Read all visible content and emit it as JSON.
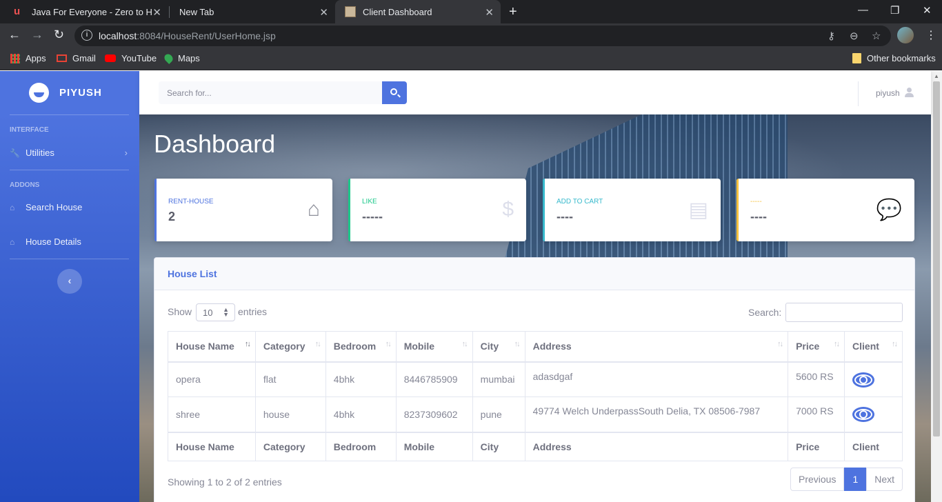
{
  "browser": {
    "tabs": [
      {
        "title": "Java For Everyone - Zero to Hero",
        "active": false
      },
      {
        "title": "New Tab",
        "active": false
      },
      {
        "title": "Client Dashboard",
        "active": true
      }
    ],
    "url_host": "localhost",
    "url_rest": ":8084/HouseRent/UserHome.jsp",
    "bookmarks": [
      "Apps",
      "Gmail",
      "YouTube",
      "Maps"
    ],
    "other_bookmarks": "Other bookmarks"
  },
  "sidebar": {
    "brand": "PIYUSH",
    "heading_interface": "INTERFACE",
    "utilities": "Utilities",
    "heading_addons": "ADDONS",
    "search_house": "Search House",
    "house_details": "House Details"
  },
  "topbar": {
    "search_placeholder": "Search for...",
    "user": "piyush"
  },
  "dashboard": {
    "title": "Dashboard",
    "cards": [
      {
        "label": "RENT-HOUSE",
        "value": "2",
        "accent": "#4e73df",
        "icon": "home-icon"
      },
      {
        "label": "LIKE",
        "value": "-----",
        "accent": "#1cc88a",
        "icon": "dollar-icon"
      },
      {
        "label": "ADD TO CART",
        "value": "----",
        "accent": "#36b9cc",
        "icon": "clipboard-icon"
      },
      {
        "label": "-----",
        "value": "----",
        "accent": "#f6c23e",
        "icon": "comments-icon"
      }
    ]
  },
  "house_list": {
    "title": "House List",
    "show": "Show",
    "page_size": "10",
    "entries": "entries",
    "search_label": "Search:",
    "columns": [
      "House Name",
      "Category",
      "Bedroom",
      "Mobile",
      "City",
      "Address",
      "Price",
      "Client"
    ],
    "rows": [
      {
        "name": "opera",
        "category": "flat",
        "bedroom": "4bhk",
        "mobile": "8446785909",
        "city": "mumbai",
        "address": "adasdgaf",
        "price": "5600 RS"
      },
      {
        "name": "shree",
        "category": "house",
        "bedroom": "4bhk",
        "mobile": "8237309602",
        "city": "pune",
        "address": "49774 Welch UnderpassSouth Delia, TX 08506-7987",
        "price": "7000 RS"
      }
    ],
    "info": "Showing 1 to 2 of 2 entries",
    "prev": "Previous",
    "page": "1",
    "next": "Next"
  },
  "colors": {
    "primary": "#4e73df",
    "success": "#1cc88a",
    "info": "#36b9cc",
    "warning": "#f6c23e"
  }
}
